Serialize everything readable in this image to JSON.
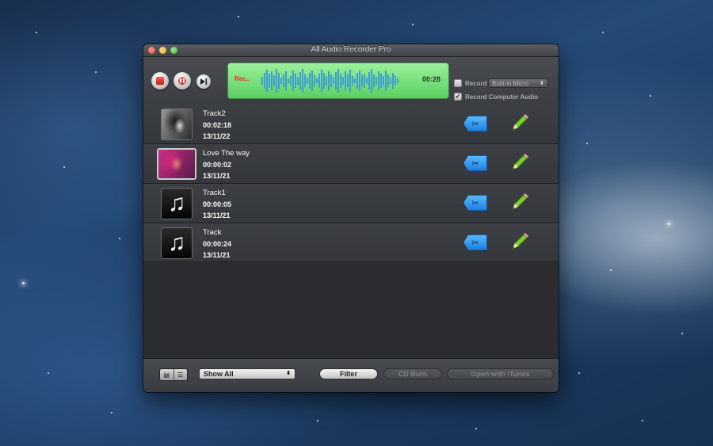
{
  "window": {
    "title": "All Audio Recorder Pro"
  },
  "recorder": {
    "status_label": "Rec..",
    "elapsed": "00:28",
    "record_mic_label": "Record",
    "record_mic_checked": false,
    "mic_source": "Built-in Micro",
    "record_computer_label": "Record Computer Audio",
    "record_computer_checked": true,
    "accent_color": "#5cce62",
    "rec_color": "#e4321f"
  },
  "tracks": [
    {
      "name": "Track2",
      "duration": "00:02:18",
      "date": "13/11/22",
      "art": "bw-photo"
    },
    {
      "name": "Love The way",
      "duration": "00:00:02",
      "date": "13/11/21",
      "art": "pink-photo"
    },
    {
      "name": "Track1",
      "duration": "00:00:05",
      "date": "13/11/21",
      "art": "music-note-icon"
    },
    {
      "name": "Track",
      "duration": "00:00:24",
      "date": "13/11/21",
      "art": "music-note-icon"
    }
  ],
  "bottom": {
    "filter_select": "Show All",
    "filter_button": "Filter",
    "cd_burn_button": "CD Burn",
    "itunes_button": "Open with iTunes"
  }
}
